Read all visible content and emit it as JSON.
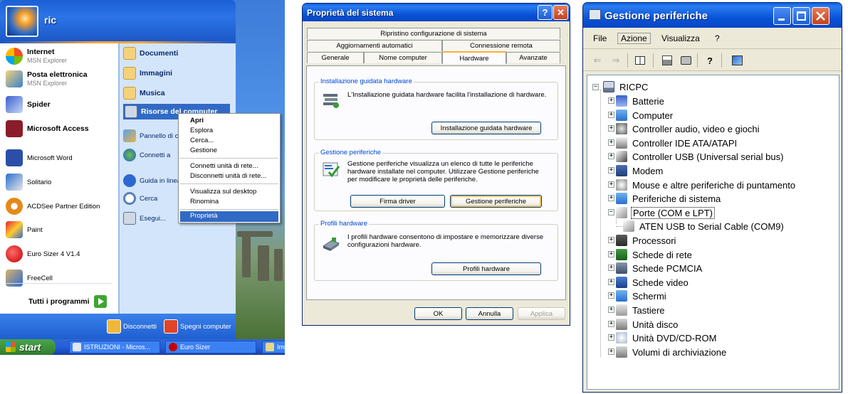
{
  "start_menu": {
    "user": "ric",
    "pinned": [
      {
        "title": "Internet",
        "subtitle": "MSN Explorer",
        "icon": "msn-butterfly-icon"
      },
      {
        "title": "Posta elettronica",
        "subtitle": "MSN Explorer",
        "icon": "mail-icon"
      },
      {
        "title": "Spider",
        "subtitle": "",
        "icon": "spider-solitaire-icon"
      },
      {
        "title": "Microsoft Access",
        "subtitle": "",
        "icon": "access-icon"
      }
    ],
    "recent": [
      {
        "title": "Microsoft Word",
        "icon": "word-icon"
      },
      {
        "title": "Solitario",
        "icon": "solitaire-icon"
      },
      {
        "title": "ACDSee Partner Edition",
        "icon": "acdsee-icon"
      },
      {
        "title": "Paint",
        "icon": "paint-icon"
      },
      {
        "title": "Euro Sizer 4 V1.4",
        "icon": "euro-sizer-icon"
      },
      {
        "title": "FreeCell",
        "icon": "freecell-icon"
      }
    ],
    "all_programs": "Tutti i programmi",
    "places": [
      {
        "title": "Documenti",
        "icon": "folder-documents-icon"
      },
      {
        "title": "Immagini",
        "icon": "folder-pictures-icon"
      },
      {
        "title": "Musica",
        "icon": "folder-music-icon"
      },
      {
        "title": "Risorse del computer",
        "icon": "my-computer-icon"
      },
      {
        "title": "Pannello di co",
        "icon": "control-panel-icon"
      },
      {
        "title": "Connetti a",
        "icon": "connect-icon"
      },
      {
        "title": "Guida in linea",
        "icon": "help-icon"
      },
      {
        "title": "Cerca",
        "icon": "search-icon"
      },
      {
        "title": "Esegui...",
        "icon": "run-icon"
      }
    ],
    "context_menu": [
      "Apri",
      "Esplora",
      "Cerca...",
      "Gestione",
      "Connetti unità di rete...",
      "Disconnetti unità di rete...",
      "Visualizza sul desktop",
      "Rinomina",
      "Proprietà"
    ],
    "footer": {
      "logoff": "Disconnetti",
      "shutdown": "Spegni computer"
    },
    "taskbar": {
      "start": "start",
      "tasks": [
        "ISTRUZIONI - Micros...",
        "Euro Sizer",
        "Imm"
      ]
    }
  },
  "system_properties": {
    "title": "Proprietà del sistema",
    "help_button": "?",
    "close_button": "✕",
    "tabs_row1": [
      "Ripristino configurazione di sistema"
    ],
    "tabs_row2": [
      "Aggiornamenti automatici",
      "Connessione remota"
    ],
    "tabs_row3": [
      "Generale",
      "Nome computer",
      "Hardware",
      "Avanzate"
    ],
    "active_tab": "Hardware",
    "groups": [
      {
        "label": "Installazione guidata hardware",
        "text": "L'Installazione guidata hardware facilita l'installazione di hardware.",
        "buttons": [
          "Installazione guidata hardware"
        ]
      },
      {
        "label": "Gestione periferiche",
        "text": "Gestione periferiche visualizza un elenco di tutte le periferiche hardware installate nel computer. Utilizzare Gestione periferiche per modificare le proprietà delle periferiche.",
        "buttons": [
          "Firma driver",
          "Gestione periferiche"
        ]
      },
      {
        "label": "Profili hardware",
        "text": "I profili hardware consentono di impostare e memorizzare diverse configurazioni hardware.",
        "buttons": [
          "Profili hardware"
        ]
      }
    ],
    "ok": "OK",
    "cancel": "Annulla",
    "apply": "Applica"
  },
  "device_manager": {
    "title": "Gestione periferiche",
    "menu": [
      "File",
      "Azione",
      "Visualizza",
      "?"
    ],
    "root": "RICPC",
    "nodes": [
      {
        "label": "Batterie",
        "icon": "battery-icon",
        "state": "+"
      },
      {
        "label": "Computer",
        "icon": "computer-icon",
        "state": "+"
      },
      {
        "label": "Controller audio, video e giochi",
        "icon": "audio-icon",
        "state": "+"
      },
      {
        "label": "Controller IDE ATA/ATAPI",
        "icon": "ide-icon",
        "state": "+"
      },
      {
        "label": "Controller USB (Universal serial bus)",
        "icon": "usb-icon",
        "state": "+"
      },
      {
        "label": "Modem",
        "icon": "modem-icon",
        "state": "+"
      },
      {
        "label": "Mouse e altre periferiche di puntamento",
        "icon": "mouse-icon",
        "state": "+"
      },
      {
        "label": "Periferiche di sistema",
        "icon": "system-device-icon",
        "state": "+"
      },
      {
        "label": "Porte (COM e LPT)",
        "icon": "port-icon",
        "state": "-",
        "selected": true
      },
      {
        "label": "ATEN USB to Serial Cable (COM9)",
        "icon": "serial-port-icon",
        "child": true
      },
      {
        "label": "Processori",
        "icon": "processor-icon",
        "state": "+"
      },
      {
        "label": "Schede di rete",
        "icon": "network-card-icon",
        "state": "+"
      },
      {
        "label": "Schede PCMCIA",
        "icon": "pcmcia-icon",
        "state": "+"
      },
      {
        "label": "Schede video",
        "icon": "display-adapter-icon",
        "state": "+"
      },
      {
        "label": "Schermi",
        "icon": "monitor-icon",
        "state": "+"
      },
      {
        "label": "Tastiere",
        "icon": "keyboard-icon",
        "state": "+"
      },
      {
        "label": "Unità disco",
        "icon": "disk-drive-icon",
        "state": "+"
      },
      {
        "label": "Unità DVD/CD-ROM",
        "icon": "dvd-drive-icon",
        "state": "+"
      },
      {
        "label": "Volumi di archiviazione",
        "icon": "storage-volume-icon",
        "state": "+"
      }
    ]
  },
  "colors": {
    "xp_blue": "#0854d8",
    "start_green": "#3c8f3c",
    "highlight": "#316ac5",
    "dialog_bg": "#ece9d8"
  }
}
